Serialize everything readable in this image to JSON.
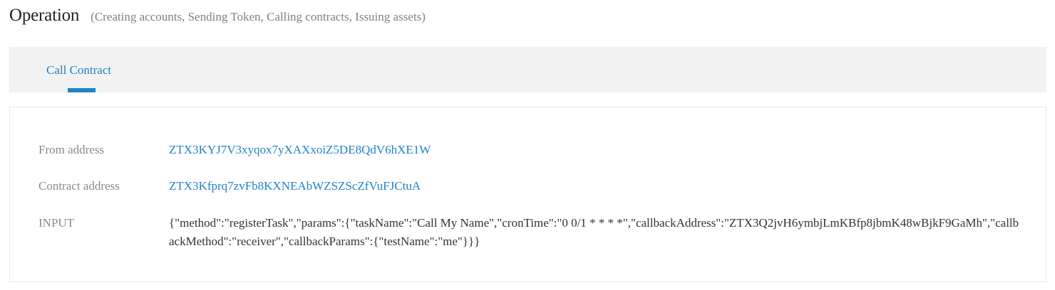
{
  "header": {
    "title": "Operation",
    "subtitle": "(Creating accounts, Sending Token, Calling contracts, Issuing assets)"
  },
  "tabs": [
    {
      "label": "Call Contract",
      "active": true
    }
  ],
  "details": {
    "from_label": "From address",
    "from_value": "ZTX3KYJ7V3xyqox7yXAXxoiZ5DE8QdV6hXE1W",
    "contract_label": "Contract address",
    "contract_value": "ZTX3Kfprq7zvFb8KXNEAbWZSZScZfVuFJCtuA",
    "input_label": "INPUT",
    "input_value": "{\"method\":\"registerTask\",\"params\":{\"taskName\":\"Call My Name\",\"cronTime\":\"0 0/1 * * * *\",\"callbackAddress\":\"ZTX3Q2jvH6ymbjLmKBfp8jbmK48wBjkF9GaMh\",\"callbackMethod\":\"receiver\",\"callbackParams\":{\"testName\":\"me\"}}}"
  },
  "colors": {
    "accent": "#1f84c4",
    "tab_background": "#f2f2f2",
    "label": "#8a8a8a",
    "text": "#333333"
  }
}
